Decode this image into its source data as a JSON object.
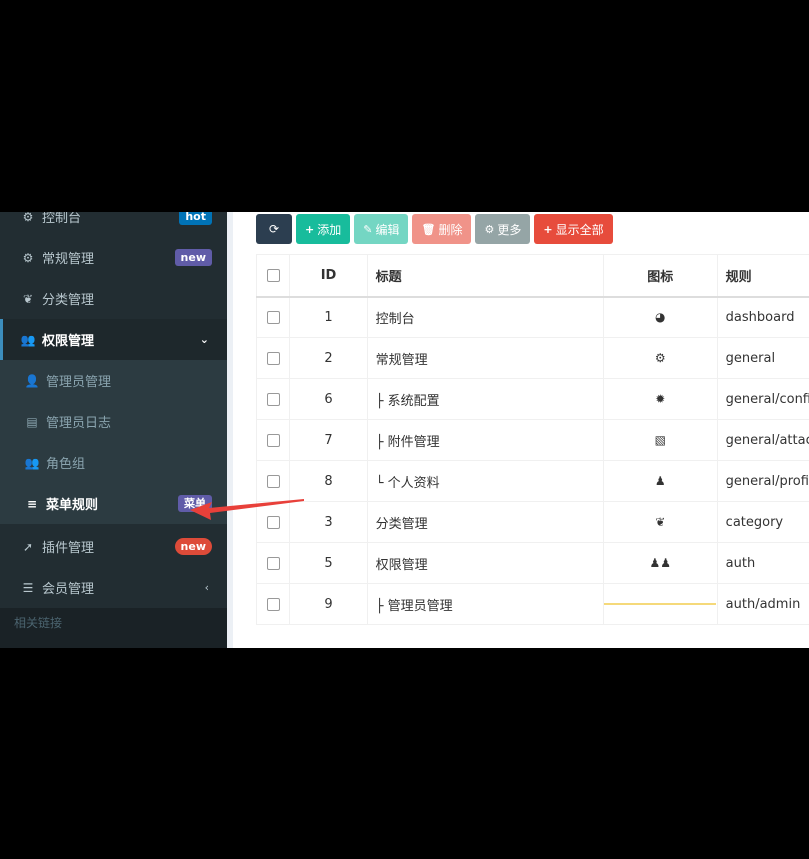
{
  "sidebar": {
    "items": [
      {
        "label": "控制台",
        "icon": "dashboard-icon",
        "glyph": "⚙",
        "badge": "hot"
      },
      {
        "label": "常规管理",
        "icon": "cogs-icon",
        "glyph": "⚙",
        "badge": "new"
      },
      {
        "label": "分类管理",
        "icon": "leaf-icon",
        "glyph": "❦"
      },
      {
        "label": "权限管理",
        "icon": "group-icon",
        "glyph": "👥",
        "chevron": "⌄"
      },
      {
        "label": "管理员管理",
        "icon": "user-icon",
        "glyph": "👤"
      },
      {
        "label": "管理员日志",
        "icon": "list-alt-icon",
        "glyph": "▤"
      },
      {
        "label": "角色组",
        "icon": "group-icon",
        "glyph": "👥"
      },
      {
        "label": "菜单规则",
        "icon": "bars-icon",
        "glyph": "≡",
        "badge": "菜单"
      },
      {
        "label": "插件管理",
        "icon": "rocket-icon",
        "glyph": "➚",
        "badge": "new"
      },
      {
        "label": "会员管理",
        "icon": "list-icon",
        "glyph": "☰",
        "chevron": "‹"
      }
    ],
    "section_header": "相关链接"
  },
  "toolbar": {
    "refresh_glyph": "⟳",
    "add": "添加",
    "add_glyph": "+",
    "edit": "编辑",
    "edit_glyph": "✎",
    "delete": "删除",
    "delete_glyph": "🗑",
    "more": "更多",
    "more_glyph": "⚙",
    "show_all": "显示全部",
    "show_all_glyph": "+"
  },
  "table": {
    "headers": {
      "id": "ID",
      "title": "标题",
      "icon": "图标",
      "rule": "规则"
    },
    "rows": [
      {
        "id": "1",
        "title": "控制台",
        "icon": "dashboard-icon",
        "glyph": "◕",
        "rule": "dashboard"
      },
      {
        "id": "2",
        "title": "常规管理",
        "icon": "cogs-icon",
        "glyph": "⚙",
        "rule": "general"
      },
      {
        "id": "6",
        "title": "├ 系统配置",
        "icon": "cog-icon",
        "glyph": "✹",
        "rule": "general/config"
      },
      {
        "id": "7",
        "title": "├ 附件管理",
        "icon": "file-image-icon",
        "glyph": "▧",
        "rule": "general/attachment"
      },
      {
        "id": "8",
        "title": "└ 个人资料",
        "icon": "user-icon",
        "glyph": "♟",
        "rule": "general/profile"
      },
      {
        "id": "3",
        "title": "分类管理",
        "icon": "leaf-icon",
        "glyph": "❦",
        "rule": "category"
      },
      {
        "id": "5",
        "title": "权限管理",
        "icon": "group-icon",
        "glyph": "♟♟",
        "rule": "auth"
      },
      {
        "id": "9",
        "title": "├ 管理员管理",
        "icon": "user-icon",
        "glyph": "",
        "rule": "auth/admin"
      }
    ]
  },
  "colors": {
    "sidebar": "#222d32",
    "accent": "#3c8dbc",
    "annotation": "#e8403a"
  }
}
